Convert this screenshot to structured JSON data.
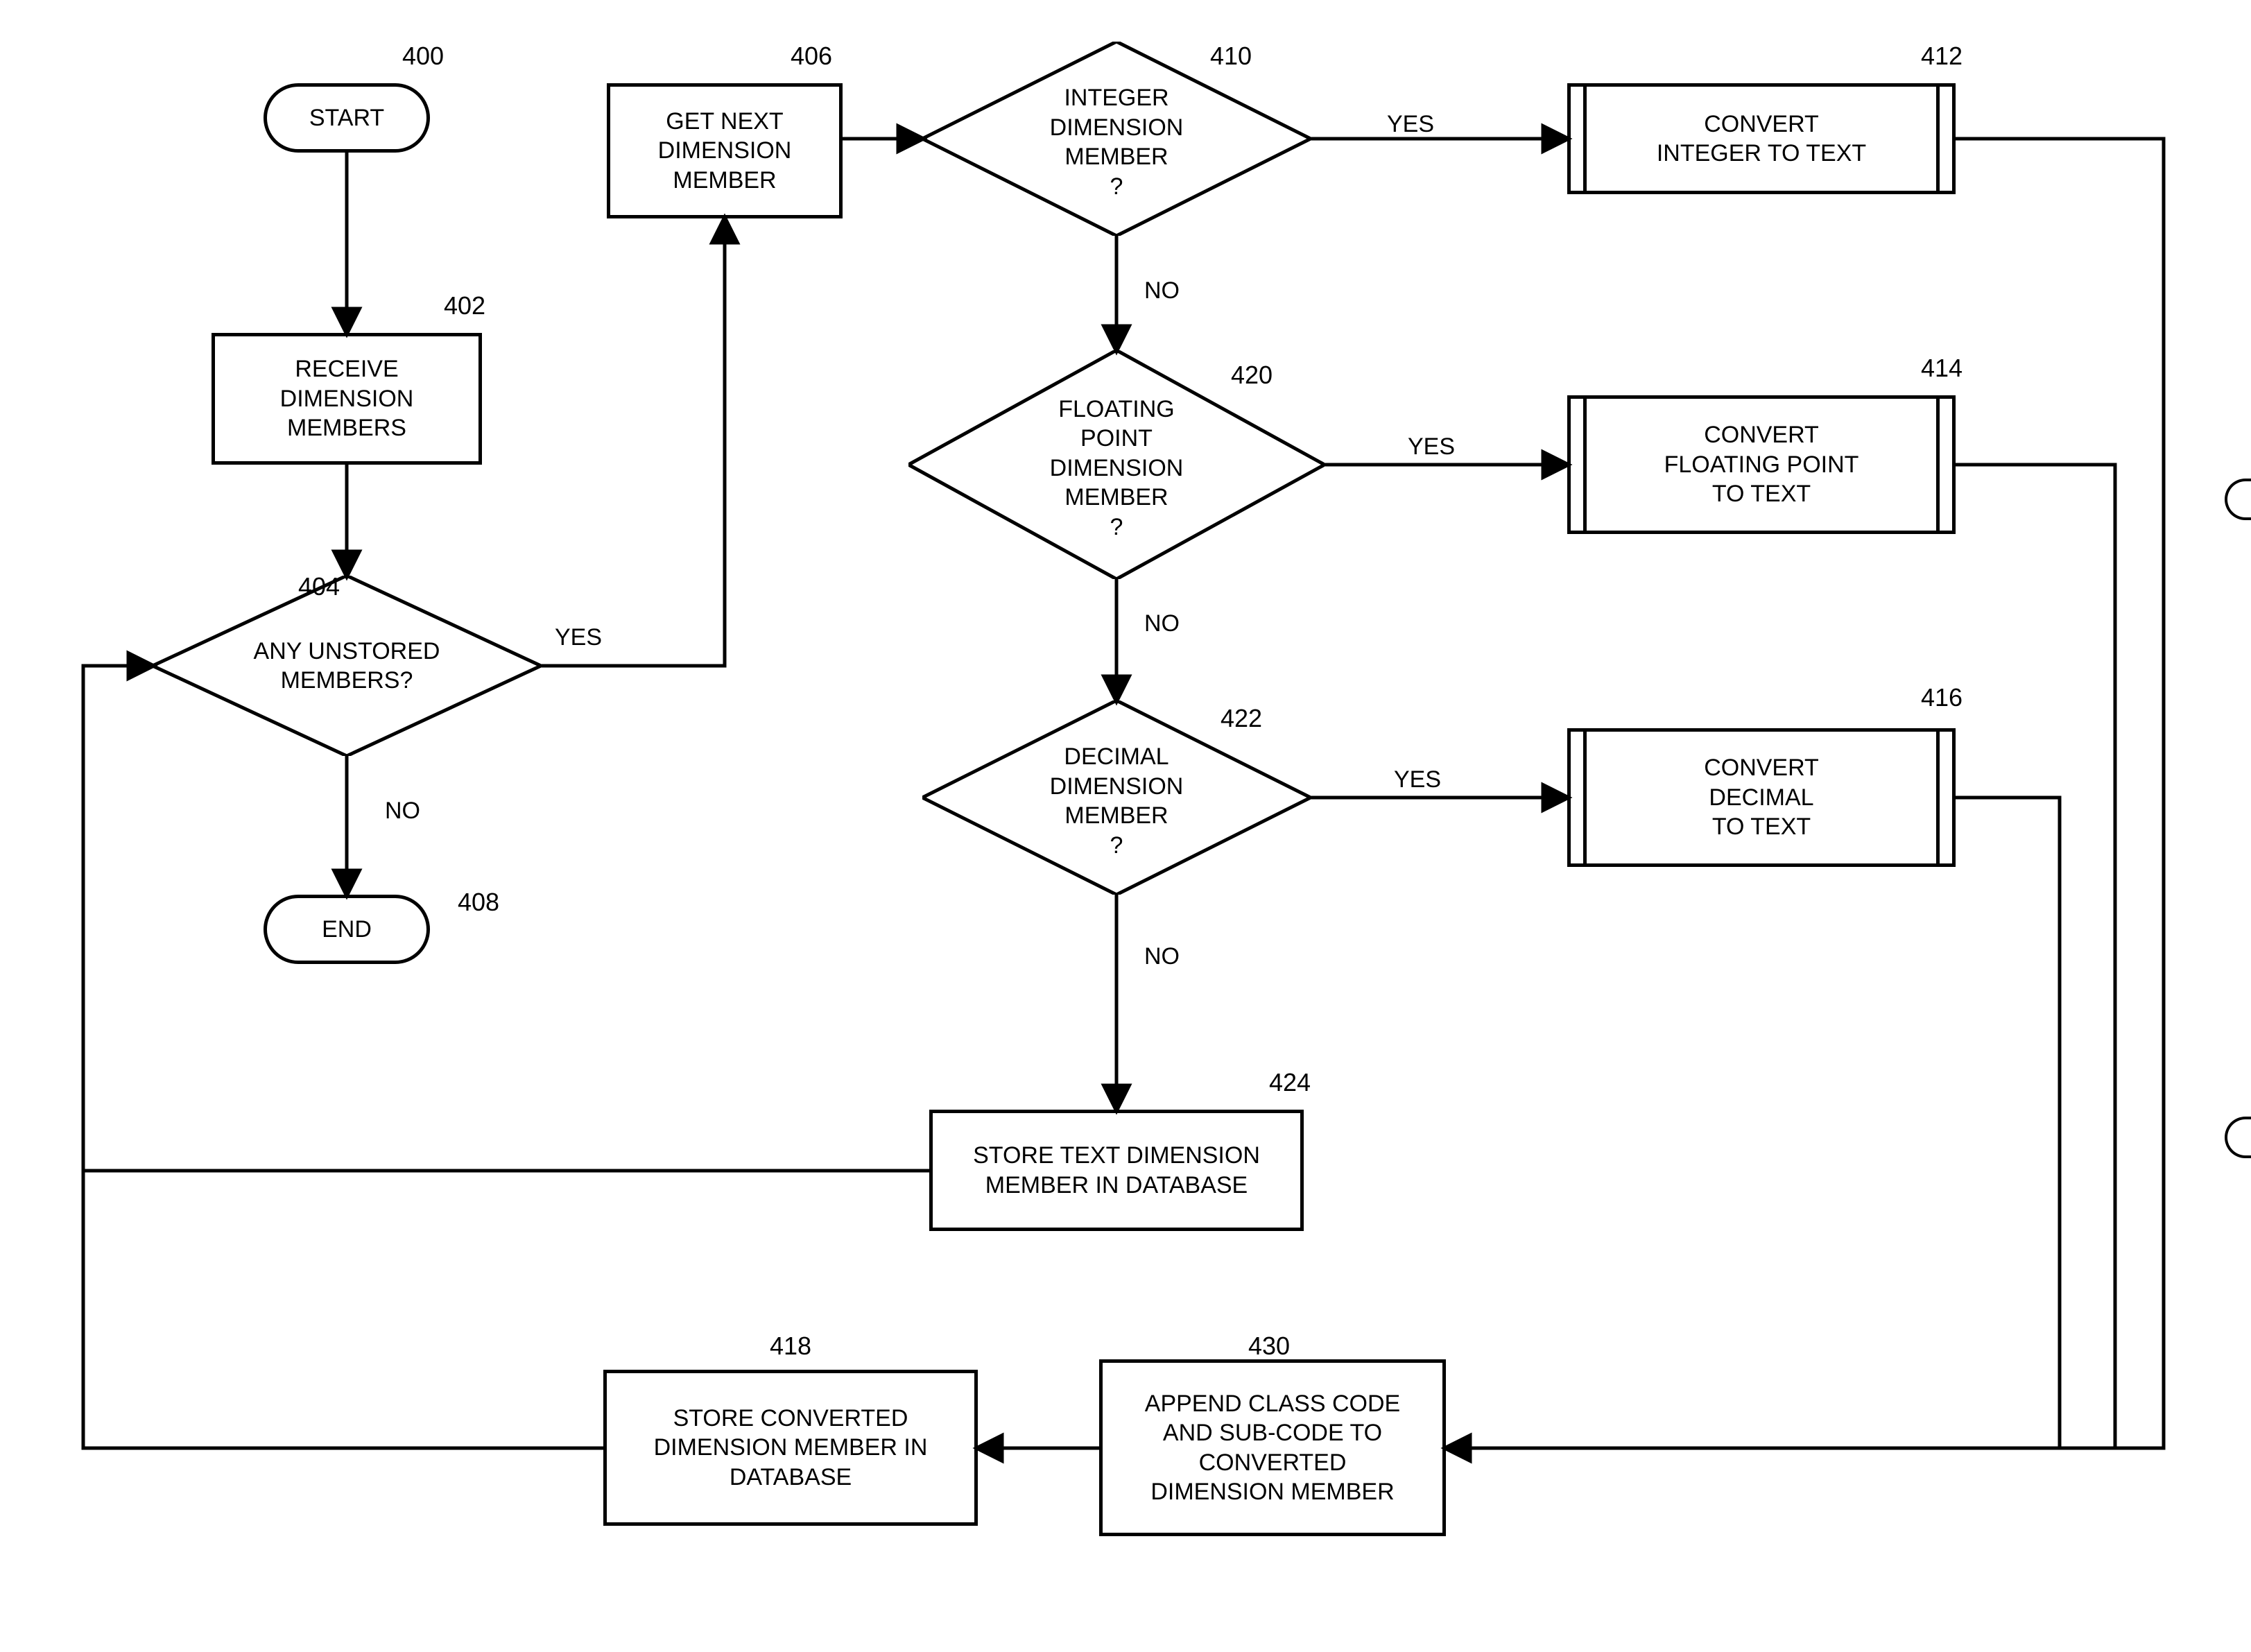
{
  "nodes": {
    "start": "START",
    "end": "END",
    "recv": "RECEIVE\nDIMENSION\nMEMBERS",
    "anyunstored": "ANY UNSTORED\nMEMBERS?",
    "getnext": "GET NEXT\nDIMENSION\nMEMBER",
    "int_q": "INTEGER\nDIMENSION\nMEMBER\n?",
    "fp_q": "FLOATING\nPOINT\nDIMENSION\nMEMBER\n?",
    "dec_q": "DECIMAL\nDIMENSION\nMEMBER\n?",
    "conv_int": "CONVERT\nINTEGER TO TEXT",
    "conv_fp": "CONVERT\nFLOATING POINT\nTO TEXT",
    "conv_dec": "CONVERT\nDECIMAL\nTO TEXT",
    "store_text": "STORE TEXT DIMENSION\nMEMBER IN DATABASE",
    "store_conv": "STORE CONVERTED\nDIMENSION MEMBER IN\nDATABASE",
    "append": "APPEND CLASS CODE\nAND SUB-CODE TO\nCONVERTED\nDIMENSION MEMBER"
  },
  "labels": {
    "n400": "400",
    "n402": "402",
    "n404": "404",
    "n406": "406",
    "n408": "408",
    "n410": "410",
    "n412": "412",
    "n414": "414",
    "n416": "416",
    "n418": "418",
    "n420": "420",
    "n422": "422",
    "n424": "424",
    "n430": "430",
    "yes": "YES",
    "no": "NO"
  }
}
